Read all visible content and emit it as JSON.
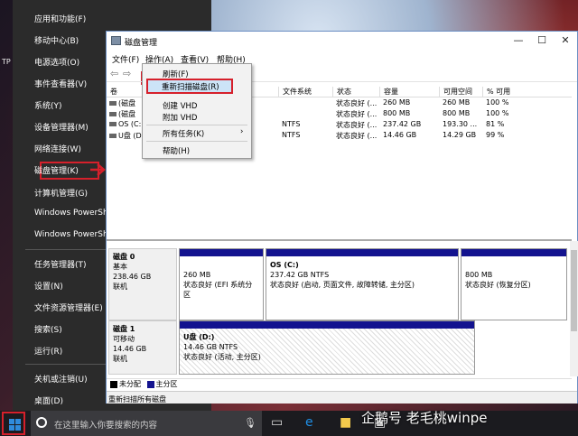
{
  "desktop": {
    "fragment": "TP"
  },
  "winx_menu": {
    "items": [
      {
        "label": "应用和功能(F)"
      },
      {
        "label": "移动中心(B)"
      },
      {
        "label": "电源选项(O)"
      },
      {
        "label": "事件查看器(V)"
      },
      {
        "label": "系统(Y)"
      },
      {
        "label": "设备管理器(M)"
      },
      {
        "label": "网络连接(W)"
      },
      {
        "label": "磁盘管理(K)"
      },
      {
        "label": "计算机管理(G)"
      },
      {
        "label": "Windows PowerShell"
      },
      {
        "label": "Windows PowerShell"
      },
      {
        "label": "任务管理器(T)"
      },
      {
        "label": "设置(N)"
      },
      {
        "label": "文件资源管理器(E)"
      },
      {
        "label": "搜索(S)"
      },
      {
        "label": "运行(R)"
      },
      {
        "label": "关机或注销(U)"
      },
      {
        "label": "桌面(D)"
      }
    ]
  },
  "window": {
    "title": "磁盘管理",
    "controls": {
      "minimize": "—",
      "maximize": "☐",
      "close": "✕"
    },
    "menu": {
      "file": "文件(F)",
      "action": "操作(A)",
      "view": "查看(V)",
      "help": "帮助(H)"
    },
    "toolbar": {
      "back": "⇦",
      "forward": "⇨"
    }
  },
  "volume_table": {
    "headers": [
      "卷",
      "文件系统",
      "状态",
      "容量",
      "可用空间",
      "% 可用"
    ],
    "rows": [
      {
        "vol": "(磁盘",
        "fs": "",
        "status": "状态良好 (...",
        "cap": "260 MB",
        "free": "260 MB",
        "pct": "100 %"
      },
      {
        "vol": "(磁盘",
        "fs": "",
        "status": "状态良好 (...",
        "cap": "800 MB",
        "free": "800 MB",
        "pct": "100 %"
      },
      {
        "vol": "OS (C:",
        "fs": "NTFS",
        "status": "状态良好 (...",
        "cap": "237.42 GB",
        "free": "193.30 ...",
        "pct": "81 %"
      },
      {
        "vol": "U盘 (D",
        "fs": "NTFS",
        "status": "状态良好 (...",
        "cap": "14.46 GB",
        "free": "14.29 GB",
        "pct": "99 %"
      }
    ]
  },
  "action_menu": {
    "refresh": "刷新(F)",
    "rescan": "重新扫描磁盘(R)",
    "create_vhd": "创建 VHD",
    "attach_vhd": "附加 VHD",
    "all_tasks": "所有任务(K)",
    "all_tasks_arrow": "›",
    "help": "帮助(H)"
  },
  "disks": [
    {
      "name": "磁盘 0",
      "type": "基本",
      "size": "238.46 GB",
      "state": "联机",
      "partitions": [
        {
          "size": "260 MB",
          "status": "状态良好 (EFI 系统分区"
        },
        {
          "title": "OS  (C:)",
          "size": "237.42 GB NTFS",
          "status": "状态良好 (启动, 页面文件, 故障转储, 主分区)"
        },
        {
          "size": "800 MB",
          "status": "状态良好 (恢复分区)"
        }
      ]
    },
    {
      "name": "磁盘 1",
      "type": "可移动",
      "size": "14.46 GB",
      "state": "联机",
      "partitions": [
        {
          "title": "U盘  (D:)",
          "size": "14.46 GB NTFS",
          "status": "状态良好 (活动, 主分区)"
        }
      ]
    }
  ],
  "legend": {
    "unallocated": "未分配",
    "primary": "主分区"
  },
  "legend_colors": {
    "unallocated": "#000000",
    "primary": "#13138f"
  },
  "statusbar": "重新扫描所有磁盘",
  "taskbar": {
    "search_placeholder": "在这里输入你要搜索的内容"
  },
  "watermark": "企鹅号 老毛桃winpe"
}
